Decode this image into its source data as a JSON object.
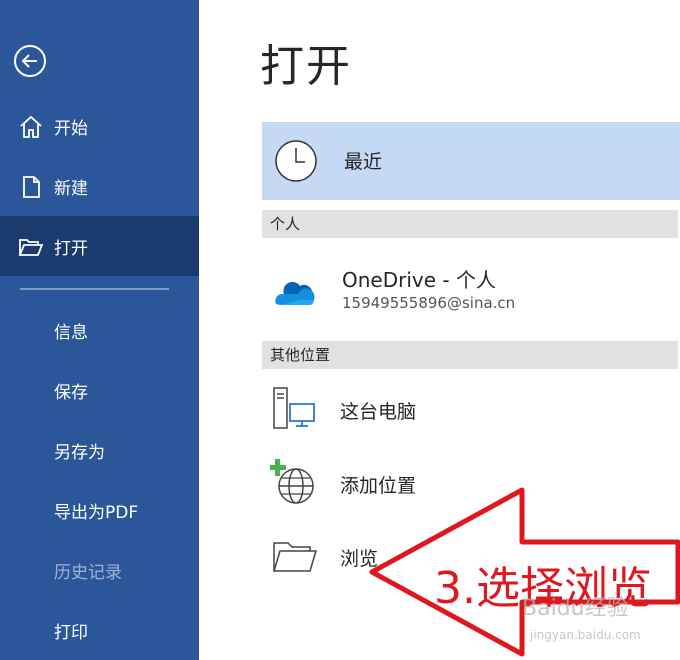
{
  "sidebar": {
    "back_icon": "back-arrow-icon",
    "items": [
      {
        "label": "开始",
        "icon": "home-icon"
      },
      {
        "label": "新建",
        "icon": "new-document-icon"
      },
      {
        "label": "打开",
        "icon": "open-folder-icon",
        "active": true
      },
      {
        "label": "信息"
      },
      {
        "label": "保存"
      },
      {
        "label": "另存为"
      },
      {
        "label": "导出为PDF"
      },
      {
        "label": "历史记录",
        "disabled": true
      },
      {
        "label": "打印"
      }
    ]
  },
  "main": {
    "title": "打开",
    "recent_label": "最近",
    "section_personal": "个人",
    "onedrive": {
      "name": "OneDrive - 个人",
      "email": "15949555896@sina.cn"
    },
    "section_other": "其他位置",
    "places": [
      {
        "label": "这台电脑",
        "icon": "computer-icon"
      },
      {
        "label": "添加位置",
        "icon": "add-location-globe-icon"
      },
      {
        "label": "浏览",
        "icon": "folder-icon"
      }
    ]
  },
  "annotation": {
    "text": "3.选择浏览",
    "color": "#e0171e"
  },
  "watermark": {
    "text": "Baidu经验",
    "sub": "jingyan.baidu.com"
  },
  "colors": {
    "sidebar": "#2b579a",
    "sidebar_active": "#1b3b6f",
    "recent_highlight": "#c5d9f5",
    "section_bar": "#e1e1e1"
  }
}
